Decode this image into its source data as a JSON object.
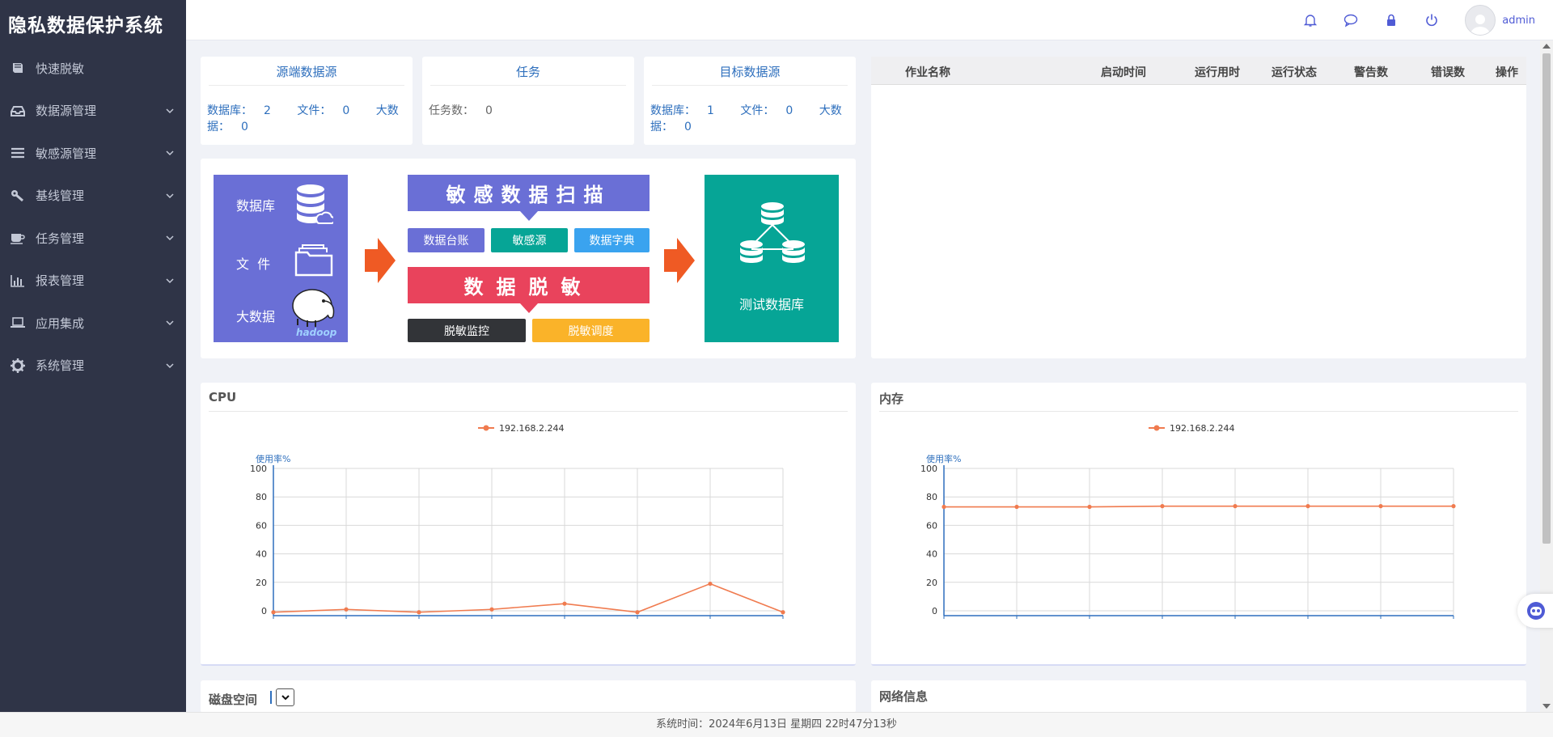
{
  "app": {
    "title": "隐私数据保护系统"
  },
  "sidebar": {
    "items": [
      {
        "label": "快速脱敏",
        "icon": "book-icon"
      },
      {
        "label": "数据源管理",
        "icon": "inbox-icon"
      },
      {
        "label": "敏感源管理",
        "icon": "list-icon"
      },
      {
        "label": "基线管理",
        "icon": "wrench-icon"
      },
      {
        "label": "任务管理",
        "icon": "coffee-icon"
      },
      {
        "label": "报表管理",
        "icon": "bar-chart-icon"
      },
      {
        "label": "应用集成",
        "icon": "laptop-icon"
      },
      {
        "label": "系统管理",
        "icon": "gear-icon"
      }
    ]
  },
  "topbar": {
    "user": "admin",
    "icons": [
      "bell-icon",
      "chat-icon",
      "lock-icon",
      "power-icon"
    ]
  },
  "stats": {
    "source": {
      "title": "源端数据源",
      "db_label": "数据库：",
      "db": "2",
      "file_label": "文件：",
      "file": "0",
      "big_label": "大数据：",
      "big": "0"
    },
    "task": {
      "title": "任务",
      "count_label": "任务数：",
      "count": "0"
    },
    "target": {
      "title": "目标数据源",
      "db_label": "数据库：",
      "db": "1",
      "file_label": "文件：",
      "file": "0",
      "big_label": "大数据：",
      "big": "0"
    }
  },
  "flow": {
    "src_db": "数据库",
    "src_file": "文  件",
    "src_big": "大数据",
    "hadoop": "hadoop",
    "scan": "敏感数据扫描",
    "ledger": "数据台账",
    "sensitive": "敏感源",
    "dict": "数据字典",
    "mask": "数据脱敏",
    "monitor": "脱敏监控",
    "schedule": "脱敏调度",
    "target_db": "测试数据库"
  },
  "jobs": {
    "columns": [
      "作业名称",
      "启动时间",
      "运行用时",
      "运行状态",
      "警告数",
      "错误数",
      "操作"
    ],
    "rows": []
  },
  "colors": {
    "sidebar": "#2f3447",
    "accent": "#4f5bd5",
    "series": "#f07b4f",
    "purple": "#6a6fd6",
    "teal": "#06a596",
    "red": "#e9435c",
    "blue": "#3aa3ef",
    "dark": "#323438",
    "yellow": "#fab329"
  },
  "cpu": {
    "title": "CPU"
  },
  "mem": {
    "title": "内存"
  },
  "disk": {
    "title": "磁盘空间"
  },
  "net": {
    "title": "网络信息"
  },
  "chart_data": [
    {
      "type": "line",
      "title": "CPU",
      "ylabel": "使用率%",
      "ylim": [
        0,
        100
      ],
      "yticks": [
        0,
        20,
        40,
        60,
        80,
        100
      ],
      "series": [
        {
          "name": "192.168.2.244",
          "values": [
            -1,
            1,
            -1,
            1,
            5,
            -1,
            19,
            -1
          ]
        }
      ]
    },
    {
      "type": "line",
      "title": "内存",
      "ylabel": "使用率%",
      "ylim": [
        0,
        100
      ],
      "yticks": [
        0,
        20,
        40,
        60,
        80,
        100
      ],
      "series": [
        {
          "name": "192.168.2.244",
          "values": [
            73,
            73,
            73,
            73.5,
            73.5,
            73.5,
            73.5,
            73.5
          ]
        }
      ]
    }
  ],
  "footer": {
    "text": "系统时间：2024年6月13日 星期四 22时47分13秒"
  }
}
